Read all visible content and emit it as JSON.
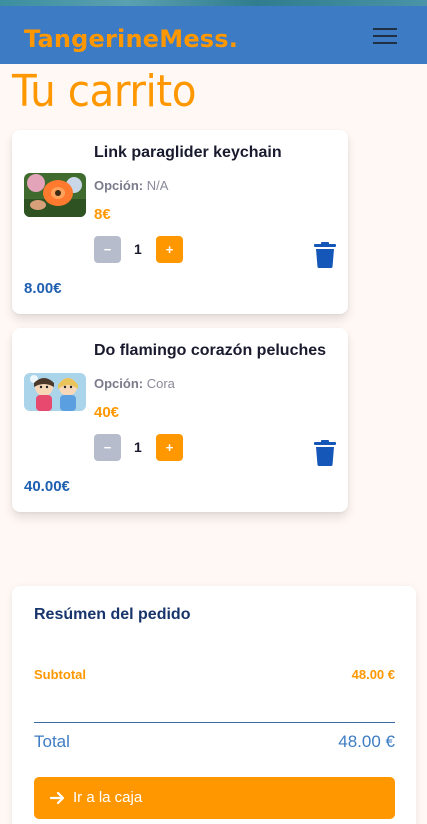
{
  "header": {
    "brand": "TangerineMess."
  },
  "page": {
    "title": "Tu carrito"
  },
  "cart": {
    "items": [
      {
        "name": "Link paraglider keychain",
        "option_label": "Opción:",
        "option_value": "N/A",
        "price": "8€",
        "quantity": "1",
        "line_total": "8.00€",
        "minus": "−",
        "plus": "+"
      },
      {
        "name": "Do flamingo corazón peluches",
        "option_label": "Opción:",
        "option_value": "Cora",
        "price": "40€",
        "quantity": "1",
        "line_total": "40.00€",
        "minus": "−",
        "plus": "+"
      }
    ]
  },
  "summary": {
    "title": "Resúmen del pedido",
    "subtotal_label": "Subtotal",
    "subtotal_value": "48.00 €",
    "total_label": "Total",
    "total_value": "48.00 €",
    "checkout_label": "Ir a la caja"
  },
  "colors": {
    "brand_orange": "#ff9800",
    "header_blue": "#3d7cc4",
    "link_blue": "#1f5fb0"
  },
  "icons": [
    "menu-icon",
    "trash-icon",
    "arrow-right-icon"
  ]
}
